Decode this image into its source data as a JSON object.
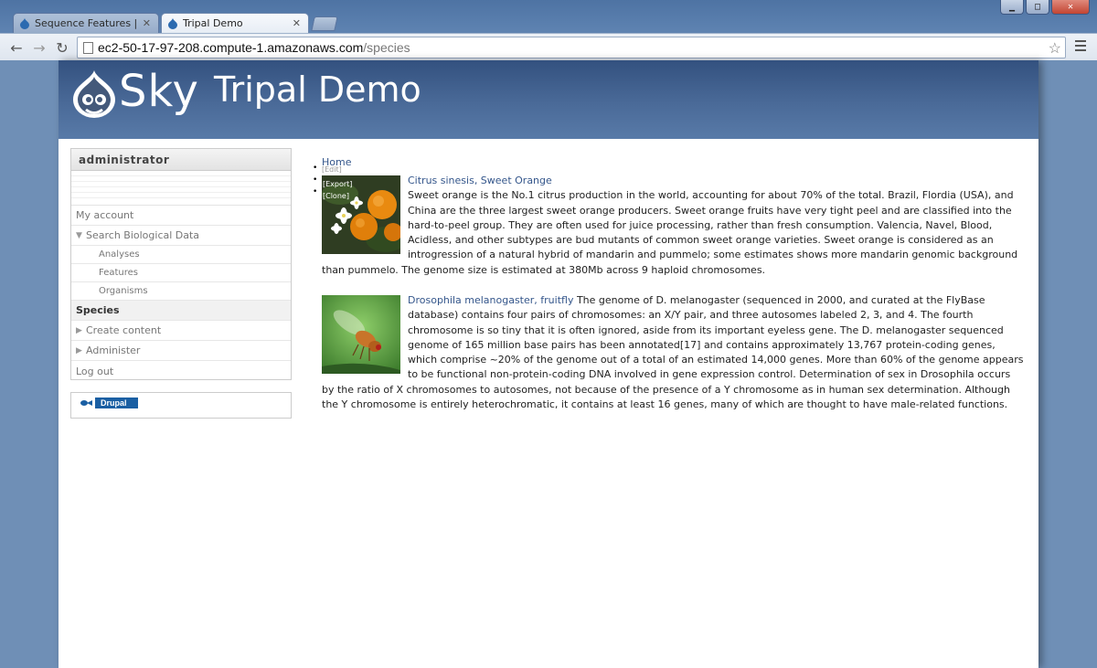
{
  "browser": {
    "tabs": [
      {
        "title": "Sequence Features | Tripal",
        "active": false
      },
      {
        "title": "Tripal Demo",
        "active": true
      }
    ],
    "url_host": "ec2-50-17-97-208.compute-1.amazonaws.com",
    "url_path": "/species"
  },
  "site": {
    "logo_text": "Sky",
    "name": "Tripal Demo"
  },
  "sidebar": {
    "title": "administrator",
    "items": [
      {
        "label": "My account"
      },
      {
        "label": "Search Biological Data",
        "arrow": "▼"
      },
      {
        "label": "Analyses"
      },
      {
        "label": "Features"
      },
      {
        "label": "Organisms"
      },
      {
        "label": "Species"
      },
      {
        "label": "Create content",
        "arrow": "▶"
      },
      {
        "label": "Administer",
        "arrow": "▶"
      },
      {
        "label": "Log out"
      }
    ]
  },
  "footer_badge": "Drupal",
  "content": {
    "breadcrumb": "Home",
    "tab_links": [
      "[Edit]",
      "[Export]",
      "[Clone]"
    ],
    "organisms": [
      {
        "name": "Citrus sinesis, Sweet Orange",
        "description": "Sweet orange is the No.1 citrus production in the world, accounting for about 70% of the total. Brazil, Flordia (USA), and China are the three largest sweet orange producers. Sweet orange fruits have very tight peel and are classified into the hard-to-peel group. They are often used for juice processing, rather than fresh consumption. Valencia, Navel, Blood, Acidless, and other subtypes are bud mutants of common sweet orange varieties. Sweet orange is considered as an introgression of a natural hybrid of mandarin and pummelo; some estimates shows more mandarin genomic background than pummelo. The genome size is estimated at 380Mb across 9 haploid chromosomes."
      },
      {
        "name": "Drosophila melanogaster, fruitfly",
        "description": "The genome of D. melanogaster (sequenced in 2000, and curated at the FlyBase database) contains four pairs of chromosomes: an X/Y pair, and three autosomes labeled 2, 3, and 4. The fourth chromosome is so tiny that it is often ignored, aside from its important eyeless gene. The D. melanogaster sequenced genome of 165 million base pairs has been annotated[17] and contains approximately 13,767 protein-coding genes, which comprise ~20% of the genome out of a total of an estimated 14,000 genes. More than 60% of the genome appears to be functional non-protein-coding DNA involved in gene expression control. Determination of sex in Drosophila occurs by the ratio of X chromosomes to autosomes, not because of the presence of a Y chromosome as in human sex determination. Although the Y chromosome is entirely heterochromatic, it contains at least 16 genes, many of which are thought to have male-related functions."
      }
    ]
  },
  "colors": {
    "link": "#34568b",
    "header": "#4a6a98"
  }
}
